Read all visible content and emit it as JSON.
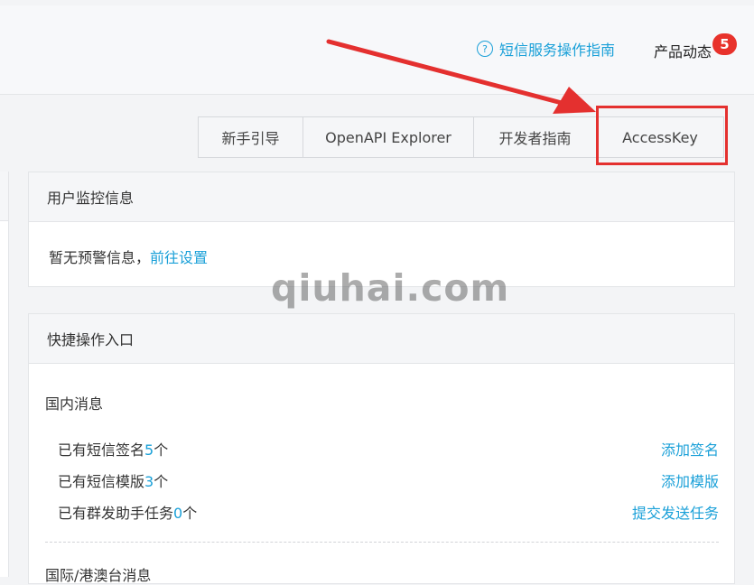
{
  "header": {
    "guide_icon": "question-circle-icon",
    "guide_link": "短信服务操作指南",
    "news_label": "产品动态",
    "news_badge": "5"
  },
  "toolbar": {
    "buttons": [
      "新手引导",
      "OpenAPI Explorer",
      "开发者指南",
      "AccessKey"
    ]
  },
  "monitor": {
    "title": "用户监控信息",
    "message": "暂无预警信息，",
    "action": "前往设置"
  },
  "quick": {
    "title": "快捷操作入口",
    "domestic_title": "国内消息",
    "rows": [
      {
        "prefix": "已有短信签名",
        "count": "5",
        "unit": "个",
        "action": "添加签名"
      },
      {
        "prefix": "已有短信模版",
        "count": "3",
        "unit": "个",
        "action": "添加模版"
      },
      {
        "prefix": "已有群发助手任务",
        "count": "0",
        "unit": "个",
        "action": "提交发送任务"
      }
    ],
    "intl_title": "国际/港澳台消息"
  },
  "watermark": "qiuhai.com",
  "colors": {
    "accent": "#1aa0d8",
    "highlight": "#e4302f",
    "badge": "#e8322b"
  }
}
